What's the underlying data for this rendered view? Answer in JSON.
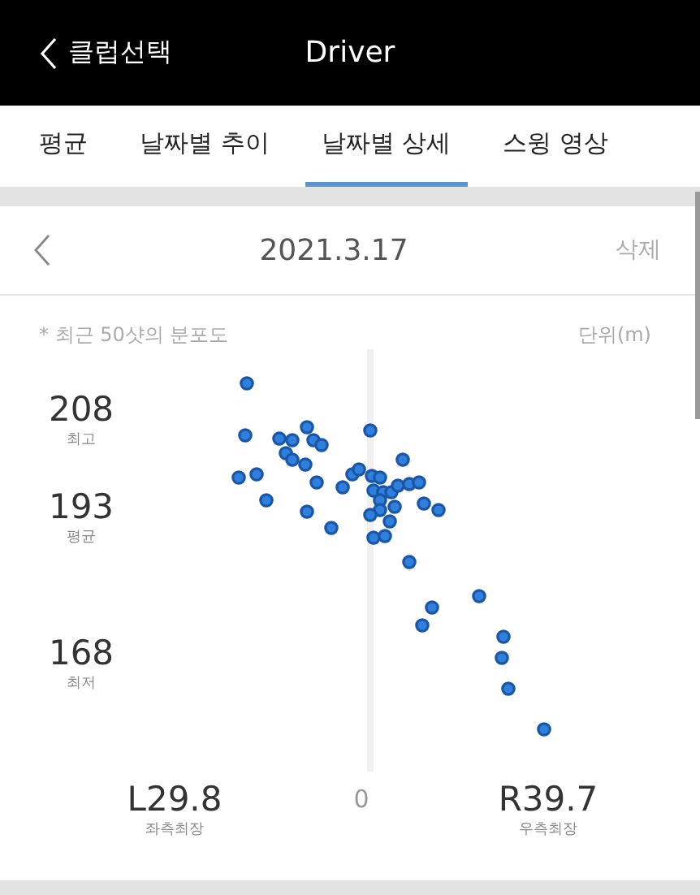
{
  "header": {
    "back_label": "클럽선택",
    "title": "Driver"
  },
  "tabs": [
    {
      "label": "평균",
      "selected": false
    },
    {
      "label": "날짜별 추이",
      "selected": false
    },
    {
      "label": "날짜별 상세",
      "selected": true
    },
    {
      "label": "스윙 영상",
      "selected": false
    }
  ],
  "date_bar": {
    "date": "2021.3.17",
    "delete_label": "삭제"
  },
  "chart": {
    "note": "* 최근 50샷의 분포도",
    "unit": "단위(m)",
    "y_labels": [
      {
        "value": "208",
        "caption": "최고"
      },
      {
        "value": "193",
        "caption": "평균"
      },
      {
        "value": "168",
        "caption": "최저"
      }
    ],
    "x_labels": [
      {
        "kind": "side",
        "value": "L29.8",
        "caption": "좌측최장"
      },
      {
        "kind": "center",
        "value": "0"
      },
      {
        "kind": "side",
        "value": "R39.7",
        "caption": "우측최장"
      }
    ]
  }
}
